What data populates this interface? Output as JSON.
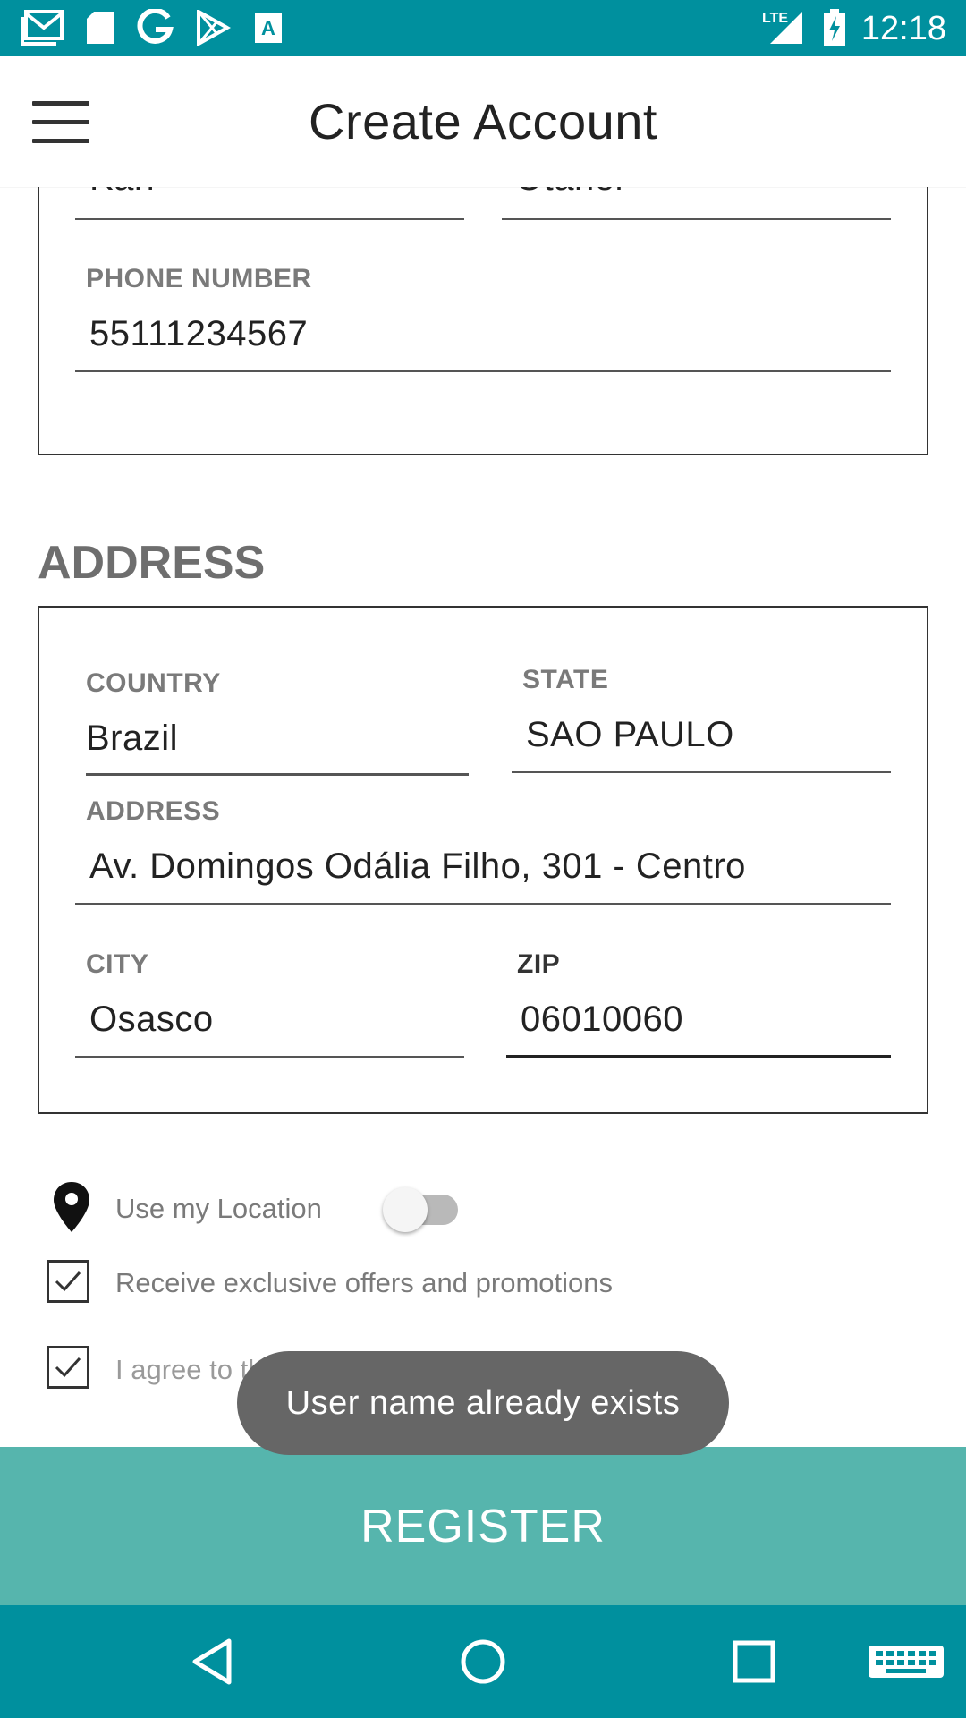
{
  "status_bar": {
    "time": "12:18",
    "network": "LTE",
    "left_icons": [
      "gmail-icon",
      "sd-card-icon",
      "google-icon",
      "play-store-icon",
      "font-app-icon"
    ],
    "right_icons": [
      "signal-icon",
      "battery-charging-icon"
    ]
  },
  "app_bar": {
    "title": "Create Account",
    "menu_icon": "hamburger-menu-icon"
  },
  "account_details": {
    "first_name_value": "Kari",
    "last_name_value": "Otaner",
    "phone_label": "PHONE NUMBER",
    "phone_value": "55111234567"
  },
  "address_section": {
    "title": "ADDRESS",
    "country_label": "COUNTRY",
    "country_value": "Brazil",
    "state_label": "STATE",
    "state_value": "SAO PAULO",
    "address_label": "ADDRESS",
    "address_value": "Av. Domingos Odália Filho, 301 - Centro",
    "city_label": "CITY",
    "city_value": "Osasco",
    "zip_label": "ZIP",
    "zip_value": "06010060"
  },
  "options": {
    "location_label": "Use my Location",
    "location_enabled": false,
    "offers_label": "Receive exclusive offers and promotions",
    "offers_checked": true,
    "agree_label": "I agree to the Advantage.com Conditions",
    "agree_checked": true
  },
  "toast": {
    "message": "User name already exists"
  },
  "register_button": {
    "label": "REGISTER"
  },
  "nav_bar": {
    "icons": [
      "back-icon",
      "home-icon",
      "recents-icon",
      "keyboard-icon"
    ]
  },
  "colors": {
    "status_bar": "#00909e",
    "register": "#56b5ad",
    "toast": "#666666"
  }
}
